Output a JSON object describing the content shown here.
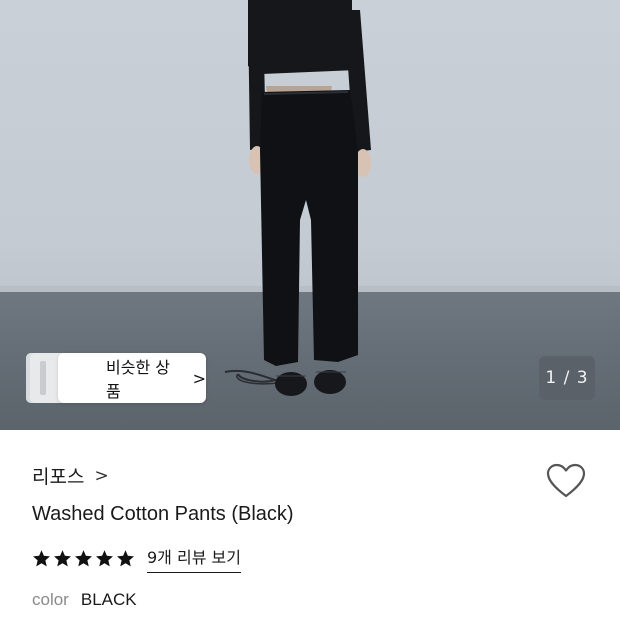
{
  "gallery": {
    "similar_button_label": "비슷한 상품",
    "similar_button_chevron": ">",
    "counter": "1 / 3",
    "current_image": 1,
    "total_images": 3
  },
  "product": {
    "brand": "리포스",
    "brand_chevron": ">",
    "name": "Washed Cotton Pants (Black)",
    "rating_stars": 5,
    "review_link": "9개 리뷰 보기",
    "color_label": "color",
    "color_value": "BLACK",
    "favorited": false
  },
  "colors": {
    "wall": "#c6cdd5",
    "floor": "#646c75",
    "garment": "#101215",
    "counter_bg": "#5a6068"
  }
}
